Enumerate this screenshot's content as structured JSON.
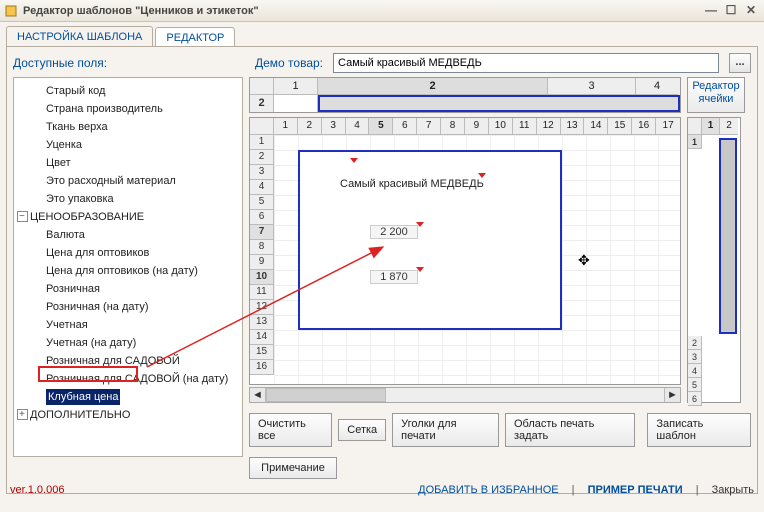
{
  "window": {
    "title": "Редактор шаблонов \"Ценников и этикеток\""
  },
  "tabs": {
    "settings": "НАСТРОЙКА ШАБЛОНА",
    "editor": "РЕДАКТОР"
  },
  "labels": {
    "available_fields": "Доступные поля:",
    "demo_product": "Демо товар:"
  },
  "demo_product_value": "Самый красивый МЕДВЕДЬ",
  "fields": {
    "items_top": [
      "Старый код",
      "Страна производитель",
      "Ткань верха",
      "Уценка",
      "Цвет",
      "Это расходный материал",
      "Это упаковка"
    ],
    "group_pricing": "ЦЕНООБРАЗОВАНИЕ",
    "pricing_items": [
      "Валюта",
      "Цена для оптовиков",
      "Цена для оптовиков (на дату)",
      "Розничная",
      "Розничная (на дату)",
      "Учетная",
      "Учетная (на дату)",
      "Розничная для САДОВОЙ",
      "Розничная для САДОВОЙ (на дату)"
    ],
    "selected_item": "Клубная цена",
    "group_additional": "ДОПОЛНИТЕЛЬНО"
  },
  "header_grid": {
    "cols": [
      "1",
      "2",
      "3",
      "4"
    ],
    "row": "2",
    "cell_editor": "Редактор ячейки"
  },
  "main_grid": {
    "cols": [
      "1",
      "2",
      "3",
      "4",
      "5",
      "6",
      "7",
      "8",
      "9",
      "10",
      "11",
      "12",
      "13",
      "14",
      "15",
      "16",
      "17"
    ],
    "rows": [
      "1",
      "2",
      "3",
      "4",
      "5",
      "6",
      "7",
      "8",
      "9",
      "10",
      "11",
      "12",
      "13",
      "14",
      "15",
      "16"
    ],
    "selected_col": "5",
    "selected_rows": [
      "7",
      "10"
    ],
    "label_text": "Самый красивый МЕДВЕДЬ",
    "price1": "2 200",
    "price2": "1 870"
  },
  "side_grid": {
    "cols": [
      "1",
      "2"
    ],
    "rows_bottom": [
      "2",
      "3",
      "4",
      "5",
      "6"
    ]
  },
  "buttons": {
    "clear_all": "Очистить все",
    "grid": "Сетка",
    "print_corners": "Уголки для печати",
    "print_area": "Область печать задать",
    "save_template": "Записать шаблон",
    "note": "Примечание",
    "demo_more": "..."
  },
  "footer": {
    "version": "ver.1.0.006",
    "add_fav": "ДОБАВИТЬ В ИЗБРАННОЕ",
    "print_example": "ПРИМЕР ПЕЧАТИ",
    "close": "Закрыть"
  }
}
